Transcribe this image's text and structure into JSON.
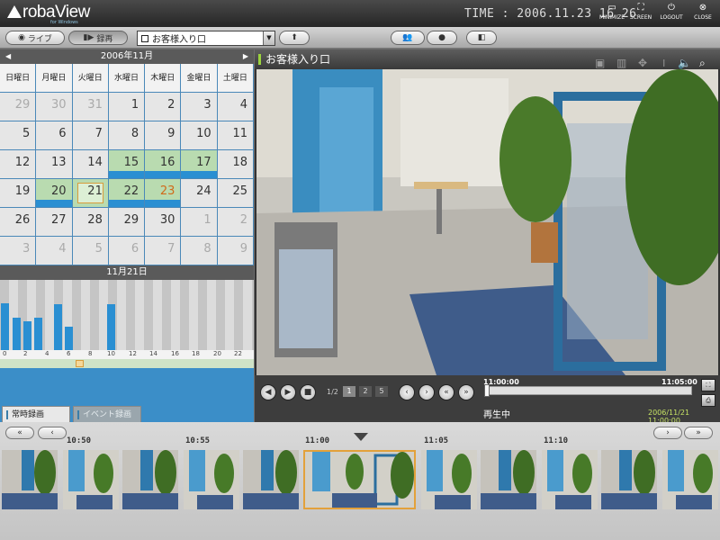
{
  "app": {
    "logo": "robaView",
    "logo_sub": "for Windows",
    "time": "TIME : 2006.11.23 16 26"
  },
  "header_buttons": [
    {
      "label": "MINIMIZE",
      "icon": "minimize-icon"
    },
    {
      "label": "SCREEN",
      "icon": "screen-icon"
    },
    {
      "label": "LOGOUT",
      "icon": "logout-icon"
    },
    {
      "label": "CLOSE",
      "icon": "close-icon"
    }
  ],
  "toolbar": {
    "live": "ライブ",
    "record": "録再",
    "camera": "お客様入り口"
  },
  "calendar": {
    "month": "2006年11月",
    "dow": [
      "日曜日",
      "月曜日",
      "火曜日",
      "水曜日",
      "木曜日",
      "金曜日",
      "土曜日"
    ],
    "days": [
      "29",
      "30",
      "31",
      "1",
      "2",
      "3",
      "4",
      "5",
      "6",
      "7",
      "8",
      "9",
      "10",
      "11",
      "12",
      "13",
      "14",
      "15",
      "16",
      "17",
      "18",
      "19",
      "20",
      "21",
      "22",
      "23",
      "24",
      "25",
      "26",
      "27",
      "28",
      "29",
      "30",
      "1",
      "2",
      "3",
      "4",
      "5",
      "6",
      "7",
      "8",
      "9"
    ]
  },
  "timeline": {
    "date": "11月21日",
    "hours": [
      "0",
      "2",
      "4",
      "6",
      "8",
      "10",
      "12",
      "14",
      "16",
      "18",
      "20",
      "22"
    ]
  },
  "video": {
    "title": "お客様入り口"
  },
  "controls": {
    "pages": "1/2",
    "page_nums": [
      "1",
      "2",
      "5"
    ],
    "start": "11:00:00",
    "end": "11:05:00",
    "status": "再生中",
    "stamp": "2006/11/21 11:00:00"
  },
  "tabs": {
    "normal": "常時録画",
    "event": "イベント録画"
  },
  "strip": {
    "times": [
      "10:50",
      "10:55",
      "11:00",
      "11:05",
      "11:10"
    ]
  }
}
